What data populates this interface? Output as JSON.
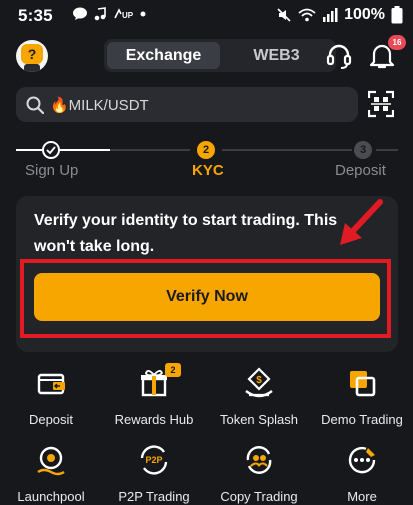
{
  "status_bar": {
    "time": "5:35",
    "battery": "100%"
  },
  "header": {
    "tabs": [
      "Exchange",
      "WEB3"
    ],
    "active_tab": "Exchange",
    "notification_count": "16"
  },
  "search": {
    "value": "🔥MILK/USDT"
  },
  "steps": {
    "step1": {
      "label": "Sign Up",
      "state": "done"
    },
    "step2": {
      "label": "KYC",
      "number": "2",
      "state": "current"
    },
    "step3": {
      "label": "Deposit",
      "number": "3",
      "state": "pending"
    }
  },
  "kyc_card": {
    "message": "Verify your identity to start trading. This won't take long.",
    "button_label": "Verify Now"
  },
  "shortcuts": {
    "deposit": "Deposit",
    "rewards_hub": "Rewards Hub",
    "rewards_badge": "2",
    "token_splash": "Token Splash",
    "demo_trading": "Demo Trading",
    "launchpool": "Launchpool",
    "p2p_trading": "P2P Trading",
    "copy_trading": "Copy Trading",
    "more": "More"
  },
  "colors": {
    "background": "#17181c",
    "accent": "#f7a600",
    "annotation_red": "#e01b24"
  }
}
